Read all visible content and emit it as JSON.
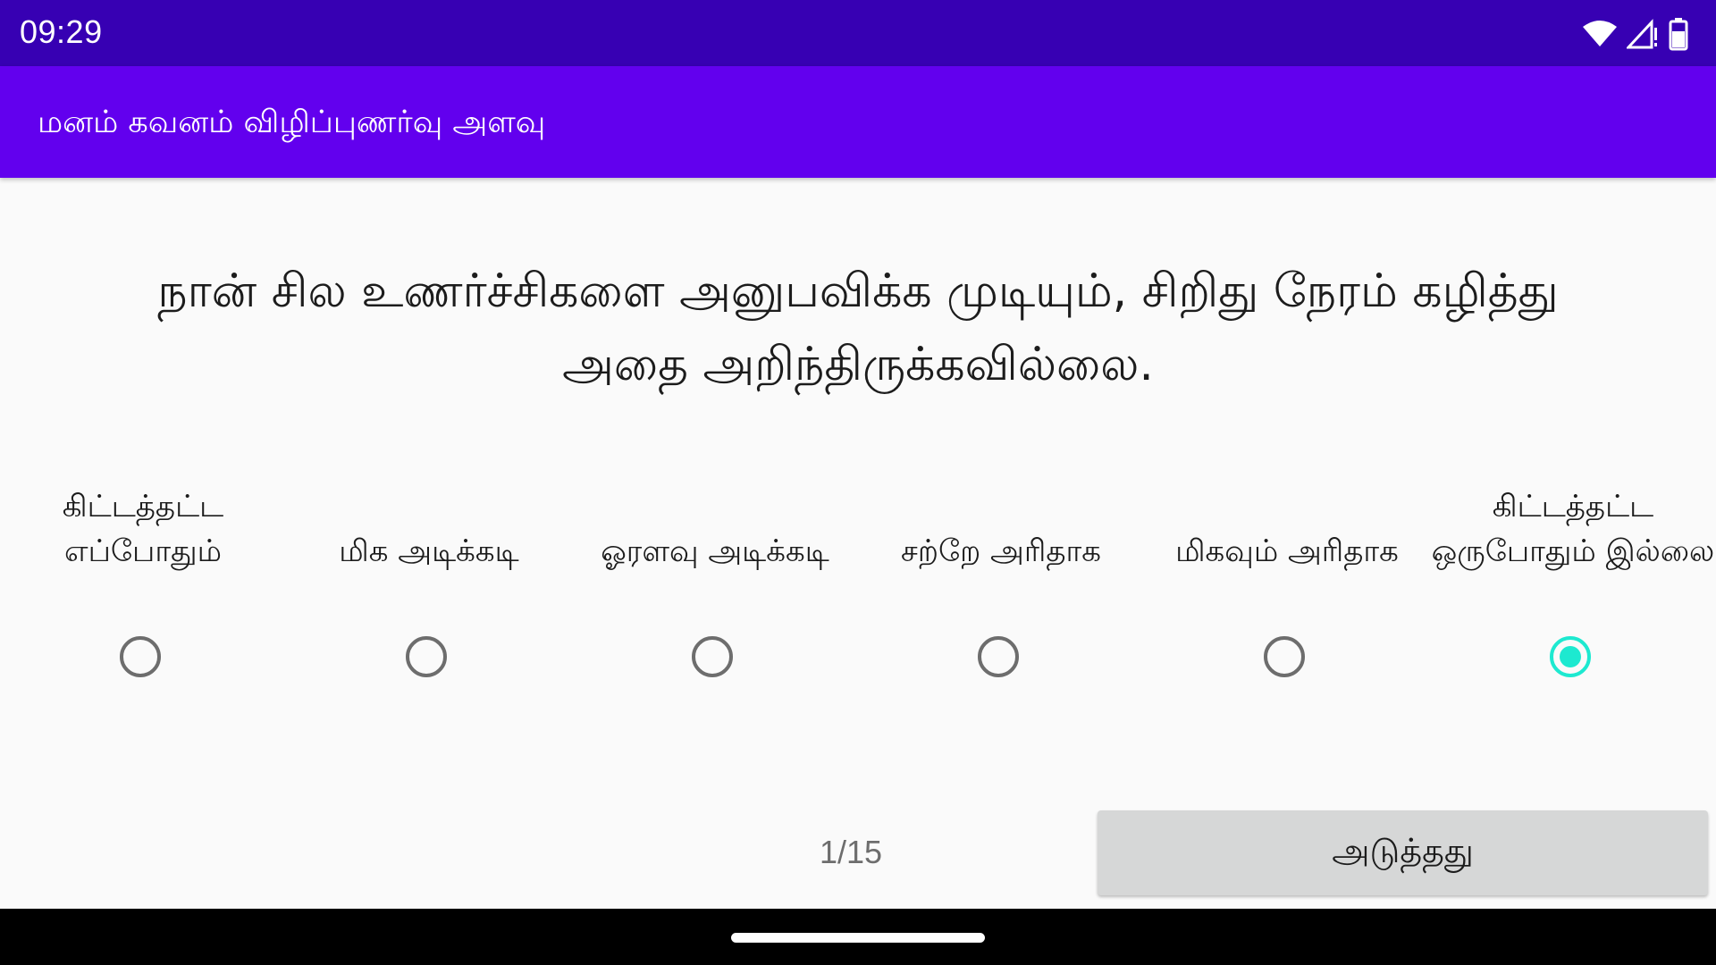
{
  "status_bar": {
    "time": "09:29",
    "icons": [
      "wifi-icon",
      "cellular-signal-icon",
      "battery-icon"
    ]
  },
  "app_bar": {
    "title": "மனம் கவனம் விழிப்புணர்வு அளவு"
  },
  "question": {
    "text": "நான் சில உணர்ச்சிகளை அனுபவிக்க முடியும், சிறிது நேரம் கழித்து அதை அறிந்திருக்கவில்லை."
  },
  "options": [
    {
      "label": "கிட்டத்தட்ட எப்போதும்",
      "selected": false
    },
    {
      "label": "மிக அடிக்கடி",
      "selected": false
    },
    {
      "label": "ஓரளவு அடிக்கடி",
      "selected": false
    },
    {
      "label": "சற்றே அரிதாக",
      "selected": false
    },
    {
      "label": "மிகவும் அரிதாக",
      "selected": false
    },
    {
      "label": "கிட்டத்தட்ட ஒருபோதும் இல்லை",
      "selected": true
    }
  ],
  "footer": {
    "progress": "1/15",
    "next_label": "அடுத்தது"
  },
  "colors": {
    "status_bar": "#3700b3",
    "app_bar": "#6200ee",
    "radio_checked": "#1de9d0",
    "radio_unchecked": "#6d6d6d",
    "button_bg": "#d6d7d7"
  }
}
